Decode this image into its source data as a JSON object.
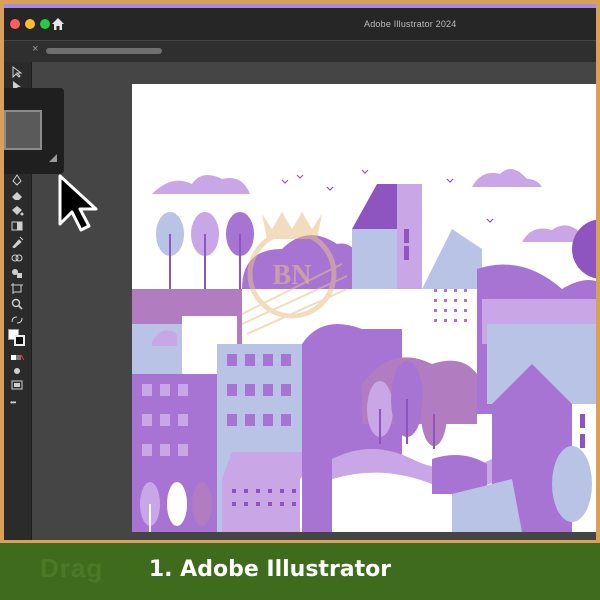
{
  "window": {
    "title": "Adobe Illustrator 2024",
    "traffic_lights": [
      "#ff5f57",
      "#febc2e",
      "#28c840"
    ]
  },
  "tabs": {
    "close_glyph": "×"
  },
  "toolbar": {
    "tools": [
      "selection-icon",
      "direct-selection-icon",
      "pen-icon",
      "eraser-icon",
      "paint-bucket-icon",
      "gradient-icon",
      "eyedropper-icon",
      "blend-icon",
      "shape-builder-icon",
      "artboard-icon",
      "zoom-icon",
      "swap-colors-icon",
      "default-colors-icon",
      "draw-mode-icon",
      "screen-mode-icon",
      "more-tools-icon"
    ],
    "more_glyph": "•••"
  },
  "artwork": {
    "palette": {
      "purple_light": "#c9a6e6",
      "purple_mid": "#a774d3",
      "purple_dark": "#8e55c0",
      "lavender": "#b8c3e6",
      "mauve": "#b27cc0",
      "white": "#ffffff"
    }
  },
  "watermark": {
    "letters": "BN"
  },
  "banner": {
    "ghost_text": "Drag",
    "caption": "1. Adobe Illustrator"
  }
}
